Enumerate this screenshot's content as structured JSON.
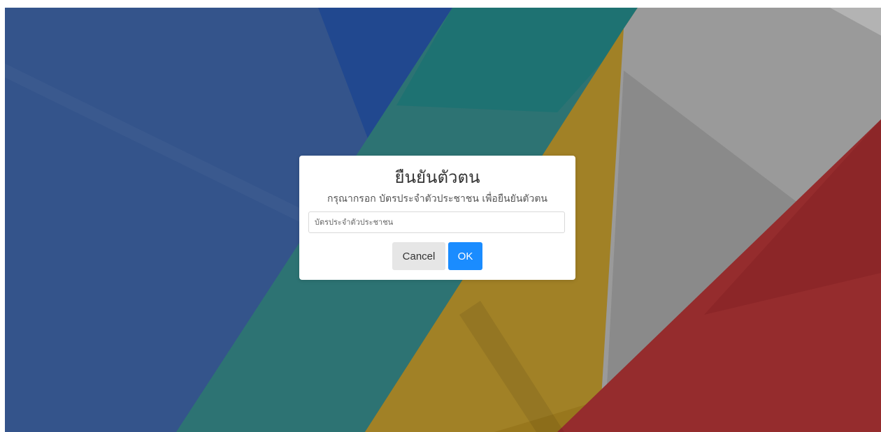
{
  "background": {
    "colors": {
      "blue": "#34548b",
      "blue_dark": "#21488f",
      "teal": "#2d7373",
      "teal_dark": "#1c7272",
      "gold": "#98771d",
      "gray": "#9a9a9a",
      "red": "#952c2d"
    }
  },
  "dialog": {
    "title": "ยืนยันตัวตน",
    "subtitle": "กรุณากรอก บัตรประจำตัวประชาชน เพื่อยืนยันตัวตน",
    "input_placeholder": "บัตรประจำตัวประชาชน",
    "input_value": "",
    "cancel_label": "Cancel",
    "ok_label": "OK",
    "colors": {
      "ok_button": "#1a8cff",
      "cancel_button": "#e6e6e6"
    }
  }
}
